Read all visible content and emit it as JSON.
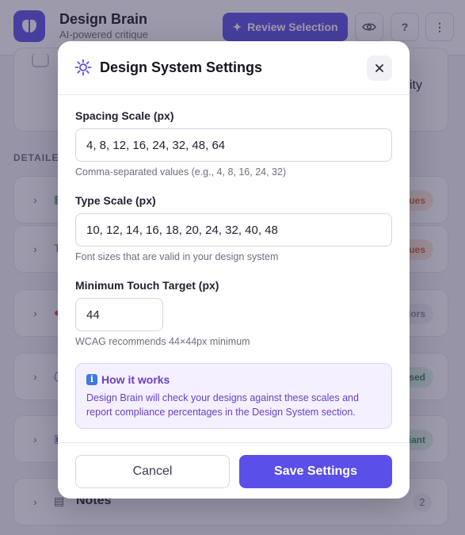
{
  "app": {
    "title": "Design Brain",
    "subtitle": "AI-powered critique",
    "review_button": "Review Selection",
    "review_icon_glyph": "✦",
    "help_glyph": "?",
    "more_glyph": "⋮"
  },
  "background": {
    "top_card_text": "ity",
    "section_label": "DETAILED",
    "rows": [
      {
        "name": "",
        "badge": "ues",
        "badge_style": "orange",
        "icon": "grid-icon",
        "icon_glyph": "▦",
        "icon_color": "#2d8a4f"
      },
      {
        "name": "",
        "badge": "ues",
        "badge_style": "orange",
        "icon": "type-icon",
        "icon_glyph": "T",
        "icon_color": "#6b6c7e"
      },
      {
        "name": "",
        "badge": "olors",
        "badge_style": "gray",
        "icon": "palette-icon",
        "icon_glyph": "●",
        "icon_color": "#d9452f"
      },
      {
        "name": "",
        "badge": "ssed",
        "badge_style": "green",
        "icon": "circle-icon",
        "icon_glyph": "◯",
        "icon_color": "#5b4fe9"
      },
      {
        "name": "",
        "badge": "liant",
        "badge_style": "green",
        "icon": "layout-icon",
        "icon_glyph": "▣",
        "icon_color": "#5b4fe9"
      },
      {
        "name": "Notes",
        "count": "2",
        "icon": "notes-icon",
        "icon_glyph": "▤",
        "icon_color": "#55566a"
      }
    ]
  },
  "modal": {
    "title": "Design System Settings",
    "close_glyph": "×",
    "spacing": {
      "label": "Spacing Scale (px)",
      "value": "4, 8, 12, 16, 24, 32, 48, 64",
      "hint": "Comma-separated values (e.g., 4, 8, 16, 24, 32)"
    },
    "type_scale": {
      "label": "Type Scale (px)",
      "value": "10, 12, 14, 16, 18, 20, 24, 32, 40, 48",
      "hint": "Font sizes that are valid in your design system"
    },
    "touch_target": {
      "label": "Minimum Touch Target (px)",
      "value": "44",
      "hint": "WCAG recommends 44×44px minimum"
    },
    "info": {
      "glyph": "i",
      "title": "How it works",
      "text": "Design Brain will check your designs against these scales and report compliance percentages in the Design System section."
    },
    "cancel_label": "Cancel",
    "save_label": "Save Settings"
  },
  "colors": {
    "accent": "#5b4fe9",
    "info_text": "#6a3fc7",
    "info_bg": "#f5f0ff"
  }
}
